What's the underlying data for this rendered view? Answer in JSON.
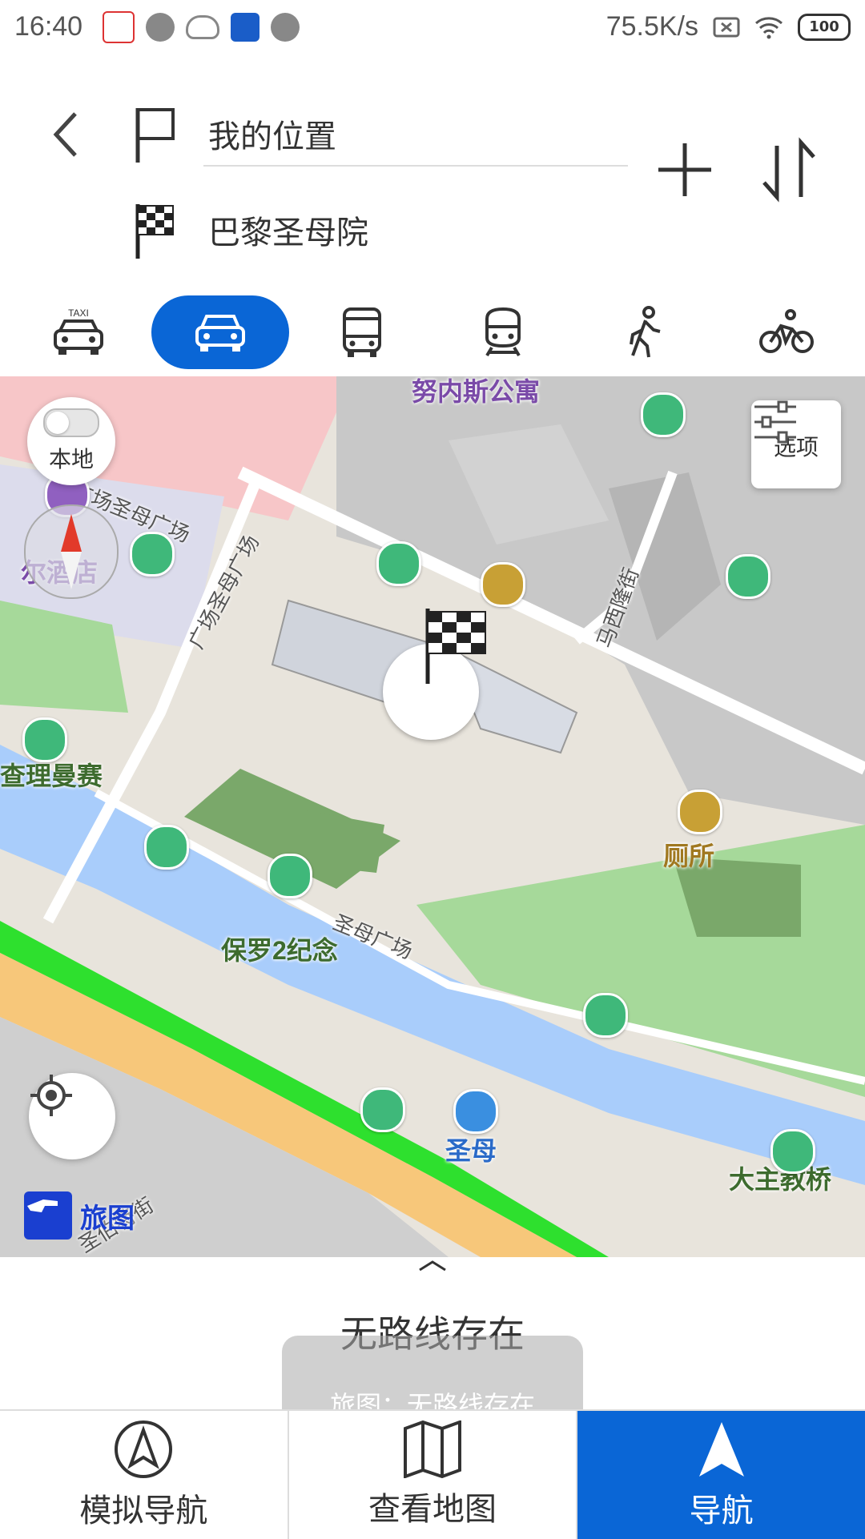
{
  "status_bar": {
    "time": "16:40",
    "speed": "75.5K/s",
    "battery": "100"
  },
  "route": {
    "start": "我的位置",
    "destination": "巴黎圣母院"
  },
  "modes": [
    {
      "name": "taxi",
      "label": "TAXI",
      "active": false
    },
    {
      "name": "car",
      "active": true
    },
    {
      "name": "bus",
      "active": false
    },
    {
      "name": "subway",
      "active": false
    },
    {
      "name": "walk",
      "active": false
    },
    {
      "name": "bike",
      "active": false
    }
  ],
  "map": {
    "local_label": "本地",
    "options_label": "选项",
    "brand_name": "旅图",
    "labels": {
      "apartment": "努内斯公寓",
      "street1": "广场圣母广场",
      "street2": "广场圣母广场",
      "hotel": "尔酒店",
      "street3": "马西隆街",
      "garden": "查理曼赛",
      "street4": "圣母广场",
      "memorial": "保罗2纪念",
      "toilet": "厕所",
      "dock": "圣母",
      "bridge": "大主教桥",
      "street5": "圣伯特街"
    }
  },
  "sheet": {
    "message": "无路线存在"
  },
  "toast": {
    "message": "旅图：无路线存在"
  },
  "tabs": {
    "simulate": "模拟导航",
    "view_map": "查看地图",
    "navigate": "导航"
  },
  "colors": {
    "accent": "#0a66d6",
    "river": "#a9cdfb",
    "park": "#a6d99a",
    "road_orange": "#f7c77a",
    "route_green": "#2ee02e"
  }
}
